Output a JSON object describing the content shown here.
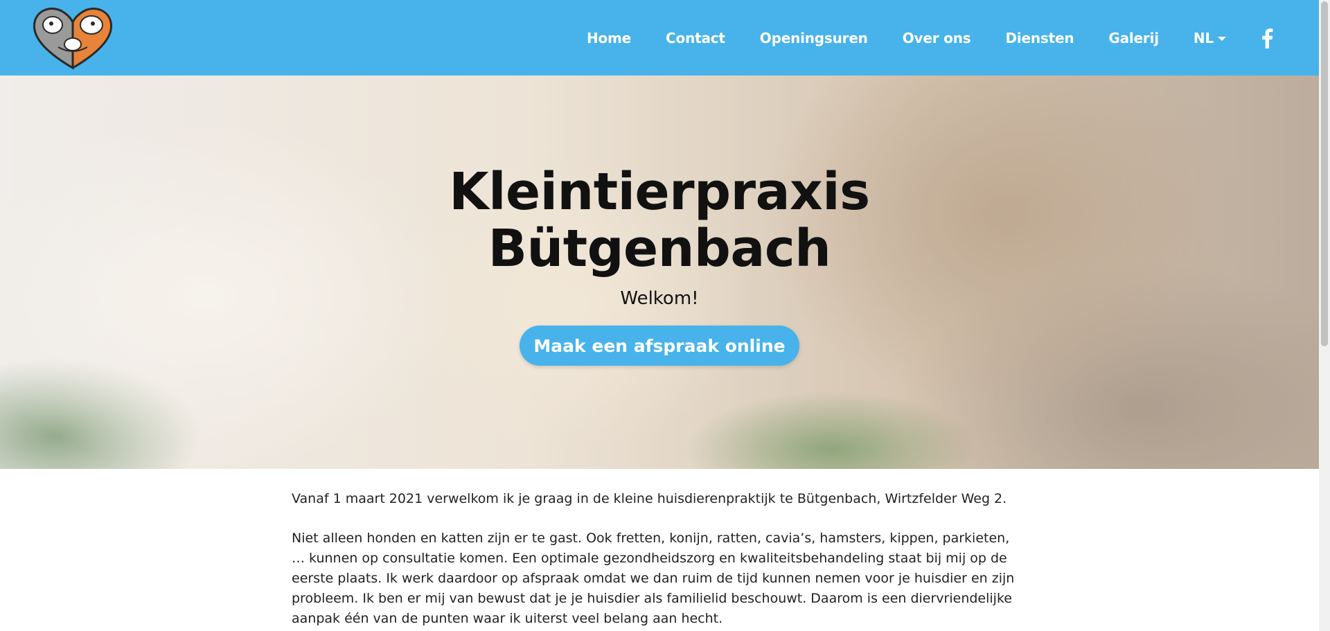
{
  "header": {
    "logo_icon": "dog-cat-heart-logo",
    "nav": [
      {
        "label": "Home"
      },
      {
        "label": "Contact"
      },
      {
        "label": "Openingsuren"
      },
      {
        "label": "Over ons"
      },
      {
        "label": "Diensten"
      },
      {
        "label": "Galerij"
      }
    ],
    "language": "NL",
    "social_icon": "facebook-icon"
  },
  "hero": {
    "title": "Kleintierpraxis Bütgenbach",
    "subtitle": "Welkom!",
    "cta_label": "Maak een afspraak online"
  },
  "content": {
    "paragraphs": [
      "Vanaf 1 maart 2021 verwelkom ik je graag in de kleine huisdierenpraktijk te Bütgenbach, Wirtzfelder Weg 2.",
      "Niet alleen honden en katten zijn er te gast. Ook fretten, konijn, ratten, cavia’s, hamsters, kippen, parkieten, … kunnen op consultatie komen. Een optimale gezondheidszorg en kwaliteitsbehandeling staat bij mij op de eerste plaats. Ik werk daardoor op afspraak omdat we dan ruim de tijd kunnen nemen voor je huisdier en zijn probleem. Ik ben er mij van bewust dat je je huisdier als familielid beschouwt. Daarom is een diervriendelijke aanpak één van de punten waar ik uiterst veel belang aan hecht."
    ]
  },
  "colors": {
    "brand": "#47b3ea",
    "text": "#222222",
    "white": "#ffffff"
  }
}
